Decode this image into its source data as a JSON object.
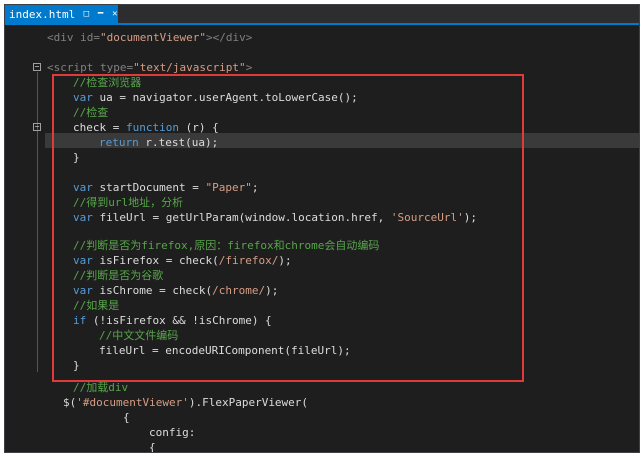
{
  "tab": {
    "title": "index.html",
    "lock_icon": "lock-icon",
    "pin_icon": "pin-icon",
    "close_icon": "close-icon"
  },
  "code": {
    "l1": {
      "a": "<div id=",
      "b": "\"documentViewer\"",
      "c": "></div>"
    },
    "l2": {
      "a": "<script type=",
      "b": "\"text/javascript\"",
      "c": ">"
    },
    "l3": "//检查浏览器",
    "l4": {
      "a": "var",
      "b": " ua = navigator.userAgent.toLowerCase();"
    },
    "l5": "//检查",
    "l6": {
      "a": "check = ",
      "b": "function",
      "c": " (r) {"
    },
    "l7": {
      "a": "return",
      "b": " r.test(ua);"
    },
    "l8": "}",
    "l9": {
      "a": "var",
      "b": " startDocument = ",
      "c": "\"Paper\"",
      "d": ";"
    },
    "l10": "//得到url地址，分析",
    "l11": {
      "a": "var",
      "b": " fileUrl = getUrlParam(window.location.href, ",
      "c": "'SourceUrl'",
      "d": ");"
    },
    "l12": "//判断是否为firefox,原因：firefox和chrome会自动编码",
    "l13": {
      "a": "var",
      "b": " isFirefox = check(",
      "c": "/firefox/",
      "d": ");"
    },
    "l14": "//判断是否为谷歌",
    "l15": {
      "a": "var",
      "b": " isChrome = check(",
      "c": "/chrome/",
      "d": ");"
    },
    "l16": "//如果是",
    "l17": {
      "a": "if",
      "b": " (!isFirefox && !isChrome) {"
    },
    "l18": "//中文文件编码",
    "l19": "fileUrl = encodeURIComponent(fileUrl);",
    "l20": "}",
    "l21": "//加载div",
    "l22": {
      "a": "$(",
      "b": "'#documentViewer'",
      "c": ").FlexPaperViewer("
    },
    "l23": "{",
    "l24": "config:",
    "l25": "{"
  }
}
